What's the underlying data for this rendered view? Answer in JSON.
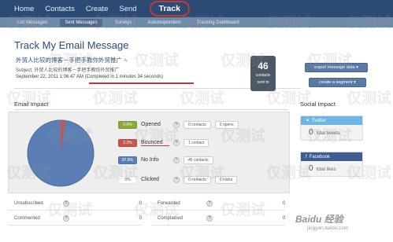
{
  "nav": {
    "items": [
      "Home",
      "Contacts",
      "Create",
      "Send",
      "Track"
    ]
  },
  "subnav": {
    "items": [
      "List Messages",
      "Sent Messages",
      "Surveys",
      "Autoresponders",
      "Tracking Dashboard"
    ]
  },
  "header": {
    "title": "Track My Email Message",
    "cn_title": "外贸人比较的博客－手把手教你外贸推广",
    "subject": "Subject: 外贸人比较的博客－手把手教你外贸推广",
    "timeline_date": "September 22, 2011 1:06:47 AM",
    "timeline_done": "(Completed in 1 minutes 34 seconds)"
  },
  "counter": {
    "value": "46",
    "label1": "contacts",
    "label2": "sent to"
  },
  "buttons": {
    "export": "export message data ▾",
    "segment": "create a segment ▾"
  },
  "email_impact": {
    "heading": "Email Impact",
    "rows": [
      {
        "pct": "0.0%",
        "name": "Opened",
        "contacts": "0 contacts",
        "extra": "0 opens",
        "color": "#8aa83b"
      },
      {
        "pct": "2.2%",
        "name": "Bounced",
        "contacts": "1 contact",
        "extra": "",
        "color": "#c9554f"
      },
      {
        "pct": "97.8%",
        "name": "No Info",
        "contacts": "45 contacts",
        "extra": "",
        "color": "#5b7fb5"
      },
      {
        "pct": "0%",
        "name": "Clicked",
        "contacts": "0 contacts",
        "extra": "0 clicks",
        "color": "#ffffff"
      }
    ]
  },
  "stats": [
    {
      "label": "Unsubscribed",
      "value": "0"
    },
    {
      "label": "Forwarded",
      "value": "0"
    },
    {
      "label": "Commented",
      "value": "0"
    },
    {
      "label": "Complained",
      "value": "0"
    }
  ],
  "social": {
    "heading": "Social Impact",
    "twitter": {
      "name": "Twitter",
      "value": "0",
      "unit": "total tweets"
    },
    "facebook": {
      "name": "Facebook",
      "value": "0",
      "unit": "total likes"
    }
  },
  "watermark": {
    "text": "仅测试",
    "logo": "Baidu 经验",
    "url": "jingyan.baidu.com"
  },
  "colors": {
    "accent": "#c0393b",
    "nav": "#2d4a75"
  }
}
